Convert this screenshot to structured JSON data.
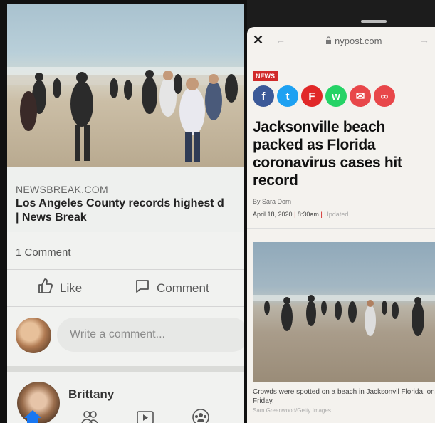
{
  "facebook": {
    "link_domain": "NEWSBREAK.COM",
    "link_headline_line1": "Los Angeles County records highest d",
    "link_headline_line2": "| News Break",
    "comments_count": "1 Comment",
    "like_label": "Like",
    "comment_label": "Comment",
    "write_comment_placeholder": "Write a comment...",
    "next_post_author": "Brittany"
  },
  "nypost": {
    "url": "nypost.com",
    "section_tag": "NEWS",
    "share_buttons": [
      {
        "icon": "facebook-icon",
        "glyph": "f",
        "color": "#3b5998"
      },
      {
        "icon": "twitter-icon",
        "glyph": "t",
        "color": "#1da1f2"
      },
      {
        "icon": "flipboard-icon",
        "glyph": "F",
        "color": "#e12828"
      },
      {
        "icon": "whatsapp-icon",
        "glyph": "w",
        "color": "#25d366"
      },
      {
        "icon": "email-icon",
        "glyph": "✉",
        "color": "#e8474a"
      },
      {
        "icon": "link-icon",
        "glyph": "∞",
        "color": "#e8474a"
      }
    ],
    "title": "Jacksonville beach packed as Florida coronavirus cases hit record",
    "byline": "By Sara Dorn",
    "date": "April 18, 2020",
    "time": "8:30am",
    "updated_label": "Updated",
    "caption": "Crowds were spotted on a beach in Jacksonvil Florida, on Friday.",
    "photo_credit": "Sam Greenwood/Getty Images"
  }
}
